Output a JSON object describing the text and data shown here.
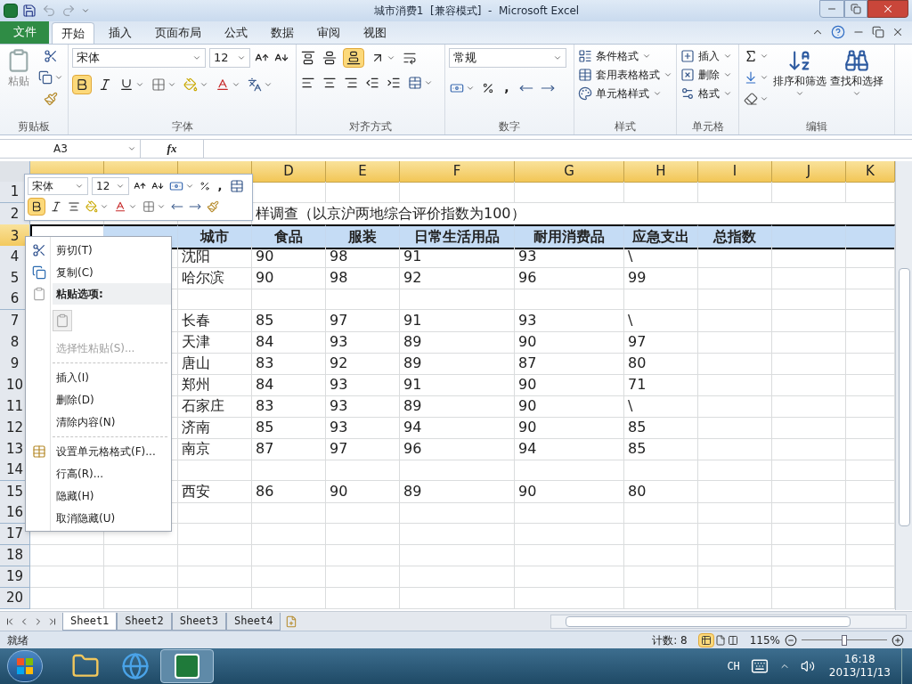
{
  "window": {
    "title": "城市消费1  [兼容模式]  -  Microsoft Excel"
  },
  "ribbon_tabs": [
    {
      "label": "文件",
      "kind": "file",
      "selected": false
    },
    {
      "label": "开始",
      "kind": "tab",
      "selected": true
    },
    {
      "label": "插入",
      "kind": "tab",
      "selected": false
    },
    {
      "label": "页面布局",
      "kind": "tab",
      "selected": false
    },
    {
      "label": "公式",
      "kind": "tab",
      "selected": false
    },
    {
      "label": "数据",
      "kind": "tab",
      "selected": false
    },
    {
      "label": "审阅",
      "kind": "tab",
      "selected": false
    },
    {
      "label": "视图",
      "kind": "tab",
      "selected": false
    }
  ],
  "ribbon": {
    "clipboard": {
      "label": "剪贴板",
      "paste": "粘贴"
    },
    "font": {
      "label": "字体",
      "font_name": "宋体",
      "font_size": "12",
      "bold": {
        "selected": true
      }
    },
    "alignment": {
      "label": "对齐方式",
      "bottom_align": {
        "selected": true
      }
    },
    "number": {
      "label": "数字",
      "format": "常规",
      "comma": ","
    },
    "styles": {
      "label": "样式",
      "items": [
        "条件格式",
        "套用表格格式",
        "单元格样式"
      ]
    },
    "cells": {
      "label": "单元格",
      "items": [
        "插入",
        "删除",
        "格式"
      ]
    },
    "editing": {
      "label": "编辑",
      "items": [
        "排序和筛选",
        "查找和选择"
      ]
    }
  },
  "formula_bar": {
    "name_box": "A3",
    "function_label": "fx"
  },
  "sheet": {
    "columns": [
      {
        "selected": true
      },
      {
        "selected": true
      },
      {
        "selected": true
      },
      {
        "label": "D",
        "selected": true
      },
      {
        "label": "E",
        "selected": true
      },
      {
        "label": "F",
        "selected": true
      },
      {
        "label": "G",
        "selected": true
      },
      {
        "label": "H",
        "selected": true
      },
      {
        "label": "I",
        "selected": true
      },
      {
        "label": "J",
        "selected": true
      },
      {
        "label": "K",
        "selected": true
      }
    ],
    "rows": [
      {
        "number": "1",
        "selected": false
      },
      {
        "number": "2",
        "selected": false,
        "kind": "title",
        "cells": [
          null,
          null,
          null,
          "样调查（以京沪两地综合评价指数为100）"
        ]
      },
      {
        "number": "3",
        "selected": true,
        "kind": "header",
        "cells": [
          null,
          null,
          "城市",
          "食品",
          "服装",
          "日常生活用品",
          "耐用消费品",
          "应急支出",
          "总指数"
        ]
      },
      {
        "number": "4",
        "selected": false,
        "cells": [
          null,
          null,
          "沈阳",
          "90",
          "98",
          "91",
          "93",
          "\\"
        ]
      },
      {
        "number": "5",
        "selected": false,
        "cells": [
          null,
          null,
          "哈尔滨",
          "90",
          "98",
          "92",
          "96",
          "99"
        ]
      },
      {
        "number": "6",
        "selected": false
      },
      {
        "number": "7",
        "selected": false,
        "cells": [
          null,
          null,
          "长春",
          "85",
          "97",
          "91",
          "93",
          "\\"
        ]
      },
      {
        "number": "8",
        "selected": false,
        "cells": [
          null,
          null,
          "天津",
          "84",
          "93",
          "89",
          "90",
          "97"
        ]
      },
      {
        "number": "9",
        "selected": false,
        "cells": [
          null,
          null,
          "唐山",
          "83",
          "92",
          "89",
          "87",
          "80"
        ]
      },
      {
        "number": "10",
        "selected": false,
        "cells": [
          null,
          null,
          "郑州",
          "84",
          "93",
          "91",
          "90",
          "71"
        ]
      },
      {
        "number": "11",
        "selected": false,
        "cells": [
          null,
          null,
          "石家庄",
          "83",
          "93",
          "89",
          "90",
          "\\"
        ]
      },
      {
        "number": "12",
        "selected": false,
        "cells": [
          null,
          null,
          "济南",
          "85",
          "93",
          "94",
          "90",
          "85"
        ]
      },
      {
        "number": "13",
        "selected": false,
        "cells": [
          null,
          null,
          "南京",
          "87",
          "97",
          "96",
          "94",
          "85"
        ]
      },
      {
        "number": "14",
        "selected": false
      },
      {
        "number": "15",
        "selected": false,
        "cells": [
          null,
          null,
          "西安",
          "86",
          "90",
          "89",
          "90",
          "80"
        ]
      },
      {
        "number": "16",
        "selected": false
      },
      {
        "number": "17",
        "selected": false
      },
      {
        "number": "18",
        "selected": false
      },
      {
        "number": "19",
        "selected": false
      },
      {
        "number": "20",
        "selected": false
      }
    ]
  },
  "mini_toolbar": {
    "font_name": "宋体",
    "font_size": "12",
    "comma": ",",
    "bold": {
      "selected": true
    }
  },
  "context_menu": [
    {
      "kind": "cut",
      "label": "剪切(T)",
      "disabled": false
    },
    {
      "kind": "copy",
      "label": "复制(C)",
      "disabled": false
    },
    {
      "kind": "heading",
      "label": "粘贴选项:",
      "disabled": false
    },
    {
      "kind": "paste-button"
    },
    {
      "kind": "plain",
      "label": "选择性粘贴(S)...",
      "disabled": true
    },
    {
      "kind": "separator"
    },
    {
      "kind": "plain",
      "label": "插入(I)",
      "disabled": false
    },
    {
      "kind": "plain",
      "label": "删除(D)",
      "disabled": false
    },
    {
      "kind": "plain",
      "label": "清除内容(N)",
      "disabled": false
    },
    {
      "kind": "separator"
    },
    {
      "kind": "format",
      "label": "设置单元格格式(F)...",
      "disabled": false
    },
    {
      "kind": "plain",
      "label": "行高(R)...",
      "disabled": false
    },
    {
      "kind": "plain",
      "label": "隐藏(H)",
      "disabled": false
    },
    {
      "kind": "plain",
      "label": "取消隐藏(U)",
      "disabled": false
    }
  ],
  "sheet_tabs": [
    {
      "label": "Sheet1",
      "selected": true
    },
    {
      "label": "Sheet2",
      "selected": false
    },
    {
      "label": "Sheet3",
      "selected": false
    },
    {
      "label": "Sheet4",
      "selected": false
    }
  ],
  "status_bar": {
    "ready": "就绪",
    "count": "计数: 8",
    "zoom": "115%",
    "zoom_slider": {
      "level": 0.5
    }
  },
  "taskbar": {
    "language": "CH",
    "time": "16:18",
    "date": "2013/11/13"
  }
}
